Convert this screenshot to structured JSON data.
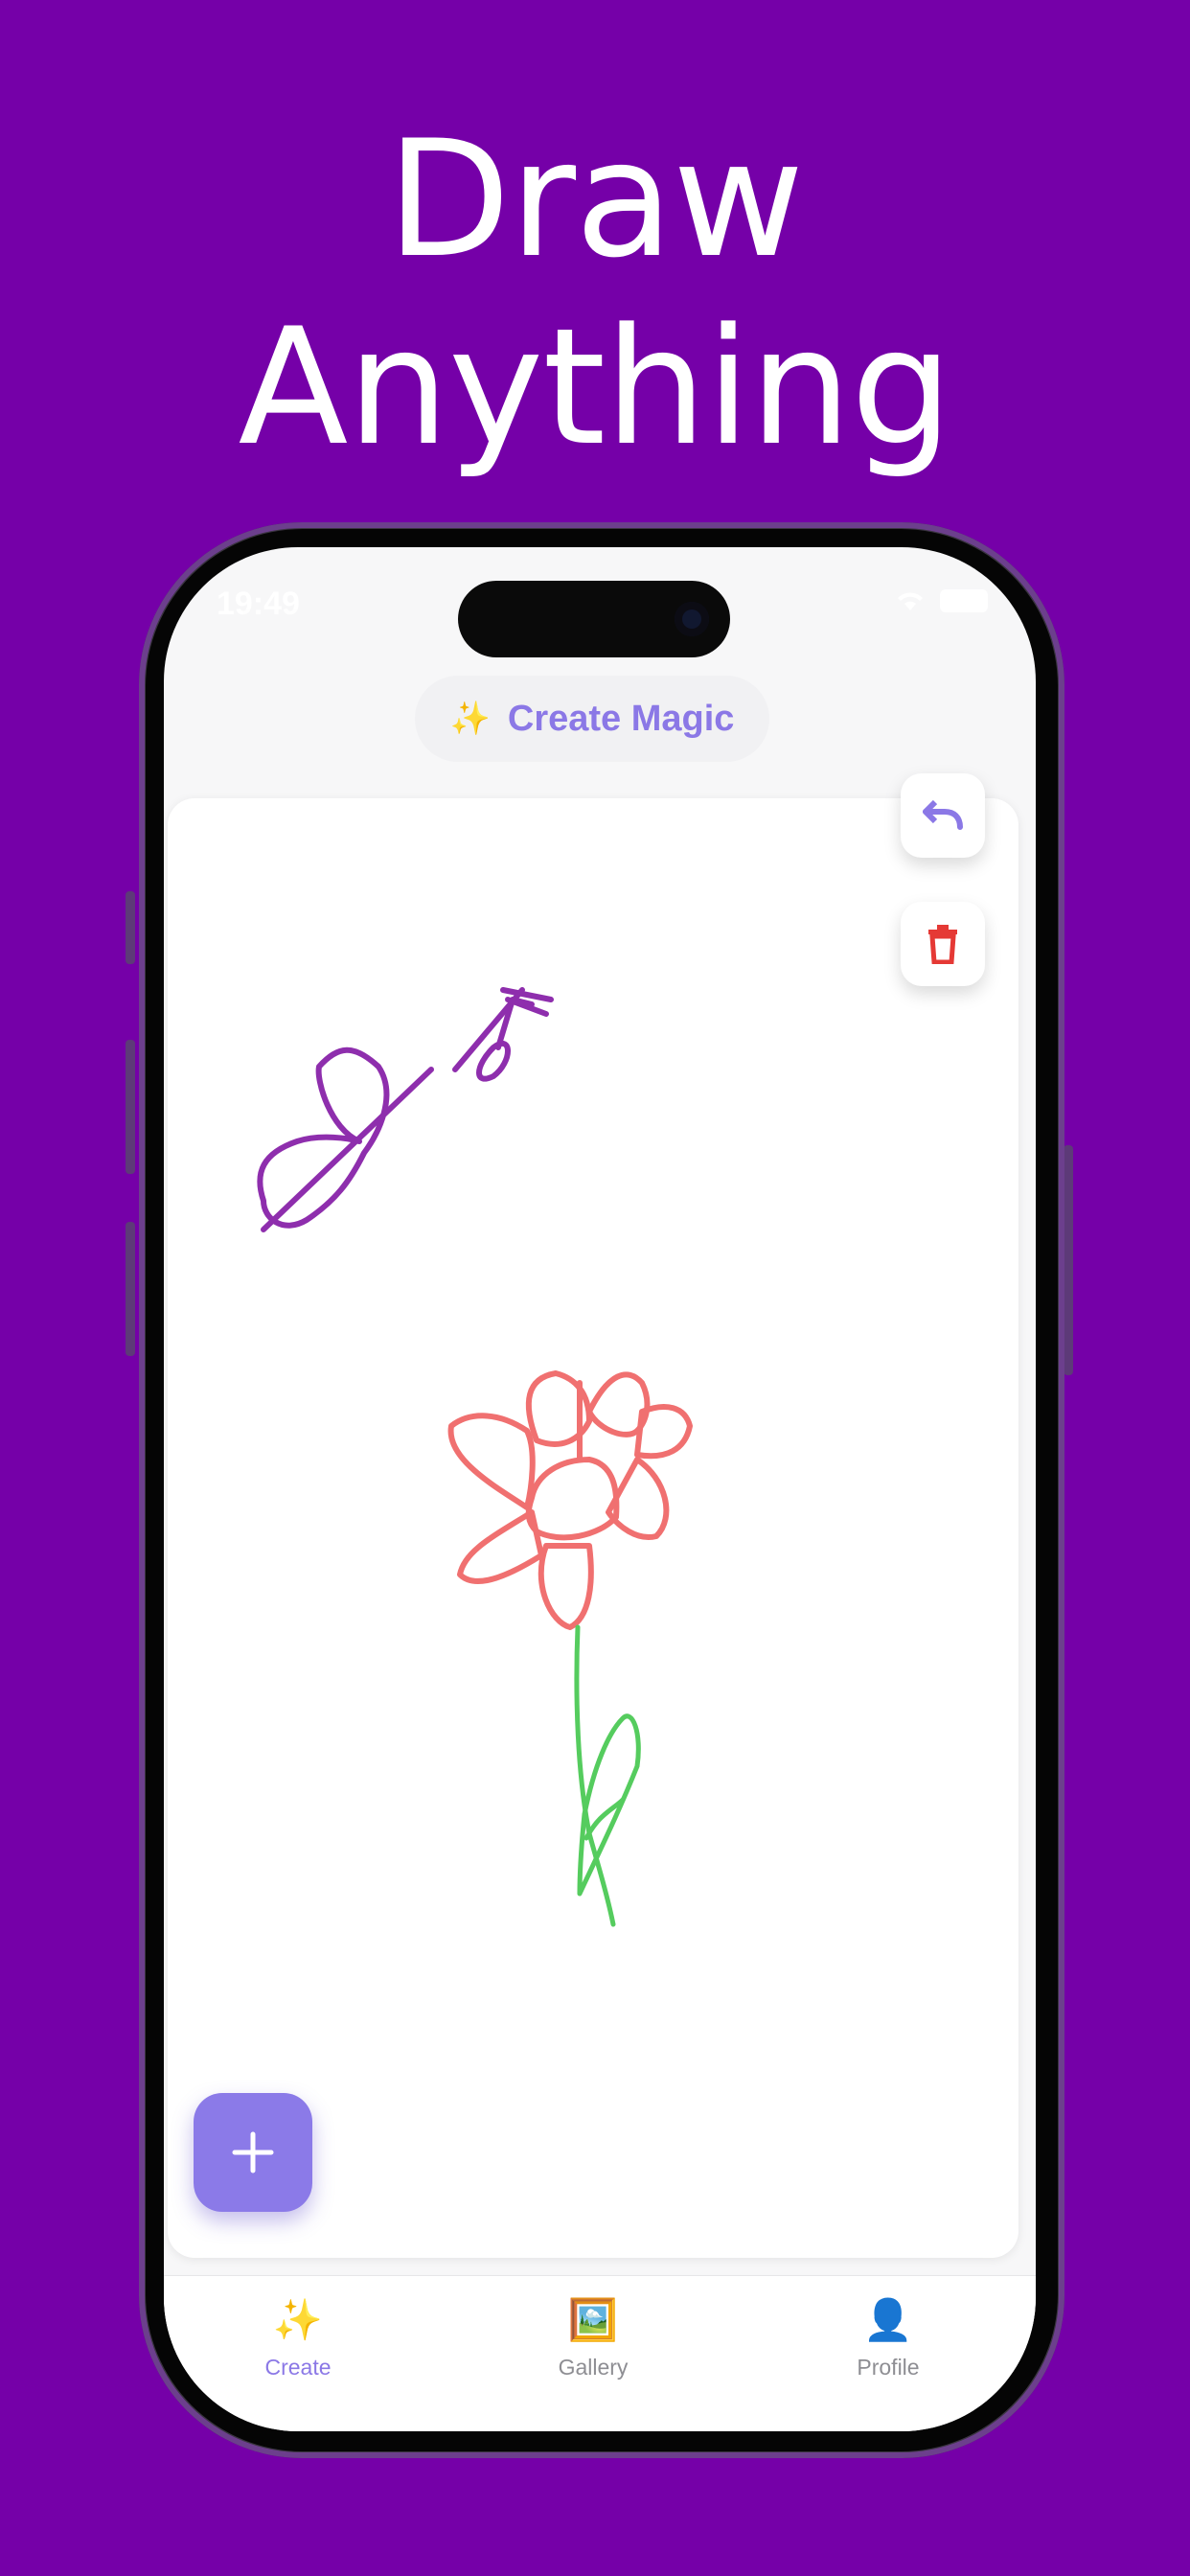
{
  "headline": {
    "line1": "Draw",
    "line2": "Anything"
  },
  "status_bar": {
    "time": "19:49"
  },
  "header": {
    "magic_button_icon": "sparkles-icon",
    "magic_button_label": "Create Magic",
    "sparkle_glyph": "✨"
  },
  "toolbar": {
    "undo_icon": "undo-icon",
    "delete_icon": "trash-icon"
  },
  "fab": {
    "label": "+",
    "icon": "plus-icon"
  },
  "tabs": [
    {
      "label": "Create",
      "glyph": "✨",
      "icon": "sparkles-icon",
      "active": true
    },
    {
      "label": "Gallery",
      "glyph": "🖼️",
      "icon": "gallery-icon",
      "active": false
    },
    {
      "label": "Profile",
      "glyph": "👤",
      "icon": "profile-icon",
      "active": false
    }
  ],
  "colors": {
    "background": "#7500A8",
    "accent": "#8B78E6",
    "butterfly_stroke": "#8E2EAD",
    "flower_stroke": "#F07070",
    "stem_stroke": "#55CC5E",
    "delete": "#E53935"
  }
}
